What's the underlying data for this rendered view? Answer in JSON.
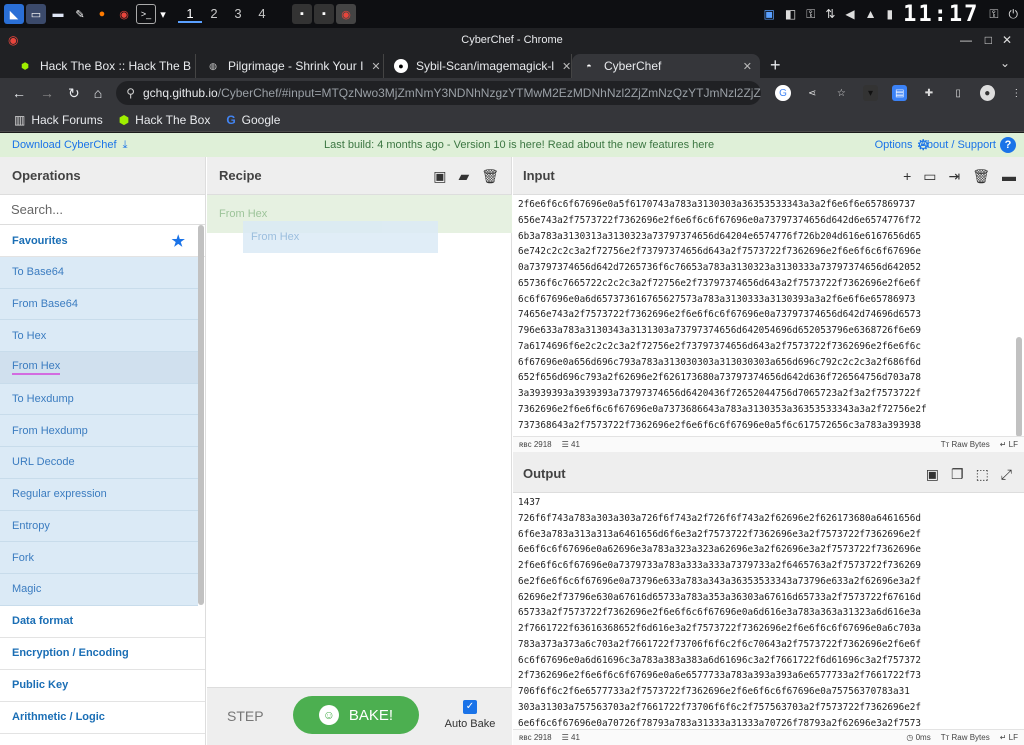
{
  "taskbar": {
    "workspaces": [
      "1",
      "2",
      "3",
      "4"
    ],
    "active_workspace": "1",
    "clock": "11:17"
  },
  "window": {
    "title": "CyberChef - Chrome"
  },
  "tabs": [
    {
      "label": "Hack The Box :: Hack The B",
      "favicon": "htb-cube-icon",
      "active": false
    },
    {
      "label": "Pilgrimage - Shrink Your I",
      "favicon": "globe-icon",
      "active": false
    },
    {
      "label": "Sybil-Scan/imagemagick-l",
      "favicon": "github-icon",
      "active": false
    },
    {
      "label": "CyberChef",
      "favicon": "chef-hat-icon",
      "active": true
    }
  ],
  "address": {
    "host": "gchq.github.io",
    "path": "/CyberChef/#input=MTQzNwo3MjZmNmY3NDNhNzgzYTMwM2EzMDNhNzl2ZjZmNzQzYTJmNzl2ZjZmNzQzYTJmNjl..."
  },
  "bookmarks": [
    {
      "label": "Hack Forums",
      "icon": "book-icon"
    },
    {
      "label": "Hack The Box",
      "icon": "htb-cube-icon"
    },
    {
      "label": "Google",
      "icon": "google-icon"
    }
  ],
  "banner": {
    "download": "Download CyberChef",
    "message": "Last build: 4 months ago - Version 10 is here! Read about the new features here",
    "options": "Options",
    "about": "About / Support"
  },
  "operations": {
    "title": "Operations",
    "search_placeholder": "Search...",
    "favourites_label": "Favourites",
    "favourites": [
      "To Base64",
      "From Base64",
      "To Hex",
      "From Hex",
      "To Hexdump",
      "From Hexdump",
      "URL Decode",
      "Regular expression",
      "Entropy",
      "Fork",
      "Magic"
    ],
    "categories": [
      "Data format",
      "Encryption / Encoding",
      "Public Key",
      "Arithmetic / Logic"
    ]
  },
  "recipe": {
    "title": "Recipe",
    "item": "From Hex",
    "dragging": "From Hex",
    "step": "STEP",
    "bake": "BAKE!",
    "auto_bake": "Auto Bake"
  },
  "input": {
    "title": "Input",
    "lines": [
      "2f6e6f6c6f67696e0a5f6170743a783a3130303a36353533343a3a2f6e6f6e657869737",
      "656e743a2f7573722f7362696e2f6e6f6c6f67696e0a73797374656d642d6e6574776f72",
      "6b3a783a3130313a3130323a73797374656d64204e6574776f726b204d616e6167656d65",
      "6e742c2c2c3a2f72756e2f73797374656d643a2f7573722f7362696e2f6e6f6c6f67696e",
      "0a73797374656d642d7265736f6c76653a783a3130323a3130333a73797374656d642052",
      "65736f6c7665722c2c2c3a2f72756e2f73797374656d643a2f7573722f7362696e2f6e6f",
      "6c6f67696e0a6d657373616765627573a783a3130333a3130393a3a2f6e6f6e65786973",
      "74656e743a2f7573722f7362696e2f6e6f6c6f67696e0a73797374656d642d74696d6573",
      "796e633a783a3130343a3131303a73797374656d642054696d652053796e6368726f6e69",
      "7a6174696f6e2c2c2c3a2f72756e2f73797374656d643a2f7573722f7362696e2f6e6f6c",
      "6f67696e0a656d696c793a783a313030303a313030303a656d696c792c2c2c3a2f686f6d",
      "652f656d696c793a2f62696e2f626173680a73797374656d642d636f726564756d703a78",
      "3a3939393a3939393a73797374656d6420436f72652044756d7065723a2f3a2f7573722f",
      "7362696e2f6e6f6c6f67696e0a7373686643a783a3130353a36353533343a3a2f72756e2f",
      "737368643a2f7573722f7362696e2f6e6f6c6f67696e0a5f6c617572656c3a783a393938",
      "3a3939383a3a2f7661722f6c6f672f6c617572656c3a2f62696e2f66616c73650a"
    ],
    "status_len": "2918",
    "status_lines": "41",
    "format": "Raw Bytes",
    "eol": "LF"
  },
  "output": {
    "title": "Output",
    "lines": [
      "1437",
      "726f6f743a783a303a303a726f6f743a2f726f6f743a2f62696e2f626173680a6461656d",
      "6f6e3a783a313a313a6461656d6f6e3a2f7573722f7362696e3a2f7573722f7362696e2f",
      "6e6f6c6f67696e0a62696e3a783a323a323a62696e3a2f62696e3a2f7573722f7362696e",
      "2f6e6f6c6f67696e0a7379733a783a333a333a7379733a2f6465763a2f7573722f736269",
      "6e2f6e6f6c6f67696e0a73796e633a783a343a36353533343a73796e633a2f62696e3a2f",
      "62696e2f73796e630a67616d65733a783a353a36303a67616d65733a2f7573722f67616d",
      "65733a2f7573722f7362696e2f6e6f6c6f67696e0a6d616e3a783a363a31323a6d616e3a",
      "2f7661722f63616368652f6d616e3a2f7573722f7362696e2f6e6f6c6f67696e0a6c703a",
      "783a373a373a6c703a2f7661722f73706f6f6c2f6c70643a2f7573722f7362696e2f6e6f",
      "6c6f67696e0a6d61696c3a783a383a383a6d61696c3a2f7661722f6d61696c3a2f757372",
      "2f7362696e2f6e6f6c6f67696e0a6e6577733a783a393a393a6e6577733a2f7661722f73",
      "706f6f6c2f6e6577733a2f7573722f7362696e2f6e6f6c6f67696e0a75756370783a31",
      "303a31303a757563703a2f7661722f73706f6f6c2f757563703a2f7573722f7362696e2f",
      "6e6f6c6f67696e0a70726f78793a783a31333a31333a70726f78793a2f62696e3a2f7573",
      "722f7362696e2f6e6f6c6f67696e0a7777772d646174613a783a33333a33333a7777772d"
    ],
    "status_len": "2918",
    "status_lines": "41",
    "time": "0ms",
    "format": "Raw Bytes",
    "eol": "LF"
  }
}
